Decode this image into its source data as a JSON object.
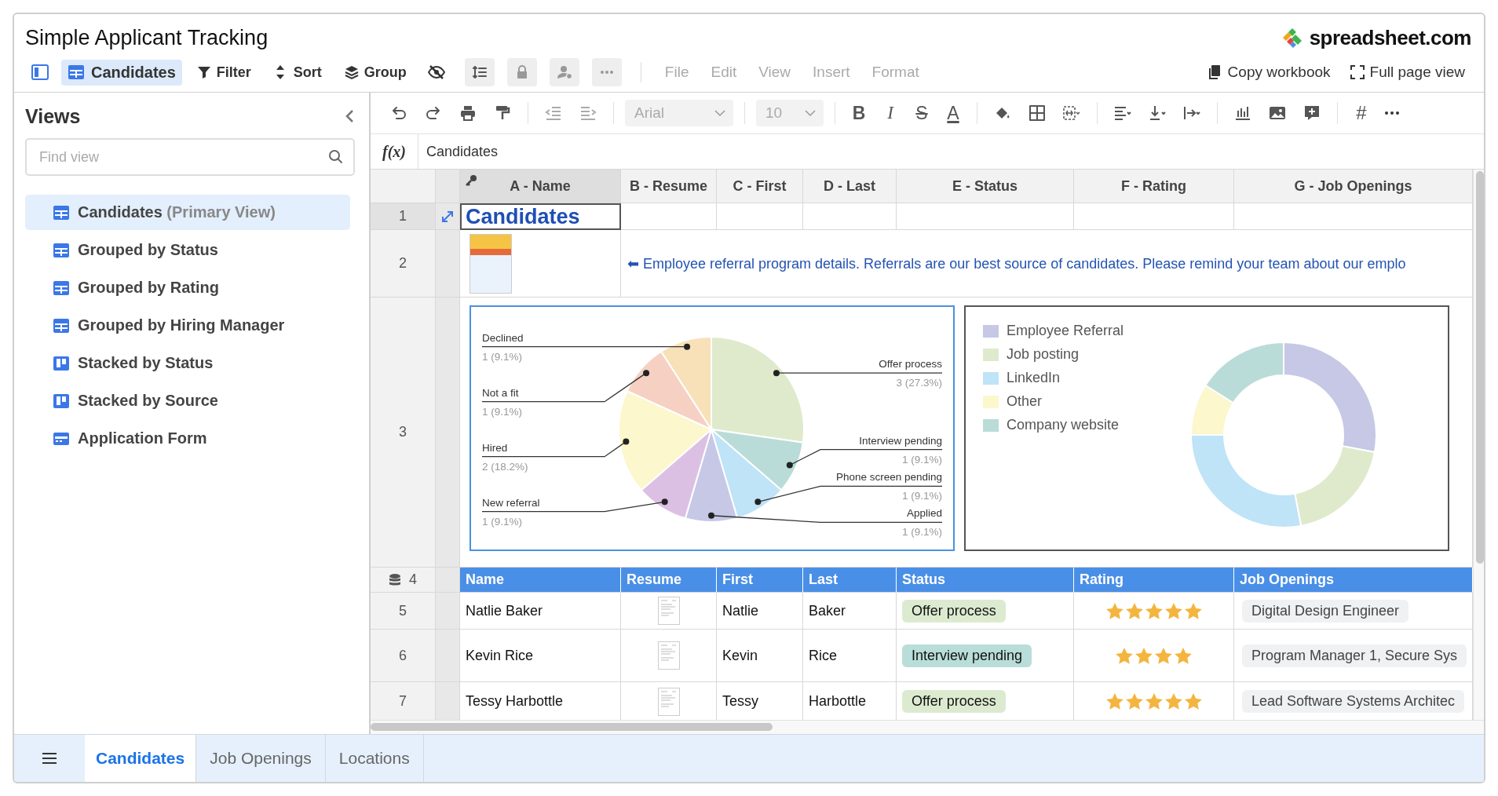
{
  "window": {
    "title": "Simple Applicant Tracking",
    "logo": "spreadsheet.com"
  },
  "toolbar": {
    "view_tab": {
      "label": "Candidates",
      "selected": true
    },
    "actions": [
      {
        "label": "Filter",
        "kind": "filter"
      },
      {
        "label": "Sort",
        "kind": "sort"
      },
      {
        "label": "Group",
        "kind": "group"
      }
    ],
    "menu": [
      {
        "label": "File",
        "disabled": true
      },
      {
        "label": "Edit",
        "disabled": true
      },
      {
        "label": "View",
        "disabled": true
      },
      {
        "label": "Insert",
        "disabled": true
      },
      {
        "label": "Format",
        "disabled": true
      }
    ],
    "links": [
      {
        "label": "Copy workbook",
        "kind": "copy"
      },
      {
        "label": "Full page view",
        "kind": "fullscreen"
      }
    ]
  },
  "sidebar": {
    "title": "Views",
    "search": {
      "placeholder": "Find view"
    },
    "items": [
      {
        "label": "Candidates",
        "note": "(Primary View)",
        "kind": "grid",
        "selected": true
      },
      {
        "label": "Grouped by Status",
        "kind": "grid",
        "selected": false
      },
      {
        "label": "Grouped by Rating",
        "kind": "grid",
        "selected": false
      },
      {
        "label": "Grouped by Hiring Manager",
        "kind": "grid",
        "selected": false
      },
      {
        "label": "Stacked by Status",
        "kind": "kanban",
        "selected": false
      },
      {
        "label": "Stacked by Source",
        "kind": "kanban",
        "selected": false
      },
      {
        "label": "Application Form",
        "kind": "form",
        "selected": false
      }
    ]
  },
  "format_toolbar": {
    "font": "Arial",
    "size": "10",
    "text_buttons": [
      {
        "glyph": "B",
        "kind": "bold"
      },
      {
        "glyph": "I",
        "kind": "italic"
      },
      {
        "glyph": "S",
        "kind": "strike"
      },
      {
        "glyph": "A",
        "kind": "color"
      }
    ],
    "number_button": "#"
  },
  "formula_bar": {
    "label": "f(x)",
    "value": "Candidates"
  },
  "sheet": {
    "columns": [
      "A - Name",
      "B - Resume",
      "C - First",
      "D - Last",
      "E - Status",
      "F - Rating",
      "G - Job Openings"
    ],
    "row_numbers": [
      "1",
      "2",
      "3",
      "4",
      "5",
      "6",
      "7"
    ],
    "title": "Candidates",
    "note": "⬅ Employee referral program details. Referrals are our best source of candidates. Please remind your team about our emplo",
    "status_chart": {
      "chart_data": {
        "type": "pie",
        "categories": [
          "Offer process",
          "Interview pending",
          "Phone screen pending",
          "Applied",
          "New referral",
          "Hired",
          "Not a fit",
          "Declined"
        ],
        "values": [
          3,
          1,
          1,
          1,
          1,
          2,
          1,
          1
        ],
        "value_labels": [
          "3 (27.3%)",
          "1 (9.1%)",
          "1 (9.1%)",
          "1 (9.1%)",
          "1 (9.1%)",
          "2 (18.2%)",
          "1 (9.1%)",
          "1 (9.1%)"
        ]
      }
    },
    "source_chart": {
      "legend": [
        {
          "label": "Employee Referral",
          "color": "#c6c8e6"
        },
        {
          "label": "Job posting",
          "color": "#dfeacd"
        },
        {
          "label": "LinkedIn",
          "color": "#bfe3f7"
        },
        {
          "label": "Other",
          "color": "#fcf7cc"
        },
        {
          "label": "Company website",
          "color": "#badcd9"
        }
      ]
    },
    "field_headers": [
      "Name",
      "Resume",
      "First",
      "Last",
      "Status",
      "Rating",
      "Job Openings"
    ],
    "records": [
      {
        "name": "Natlie Baker",
        "first": "Natlie",
        "last": "Baker",
        "status": {
          "label": "Offer process",
          "color": "#dcebd0"
        },
        "stars": 5,
        "job_opening": "Digital Design Engineer"
      },
      {
        "name": "Kevin Rice",
        "first": "Kevin",
        "last": "Rice",
        "status": {
          "label": "Interview pending",
          "color": "#b9ddd9"
        },
        "stars": 4,
        "job_opening": "Program Manager 1, Secure Sys"
      },
      {
        "name": "Tessy Harbottle",
        "first": "Tessy",
        "last": "Harbottle",
        "status": {
          "label": "Offer process",
          "color": "#dcebd0"
        },
        "stars": 5,
        "job_opening": "Lead Software Systems Architec"
      }
    ]
  },
  "sheet_tabs": [
    {
      "label": "Candidates",
      "selected": true
    },
    {
      "label": "Job Openings",
      "selected": false
    },
    {
      "label": "Locations",
      "selected": false
    }
  ]
}
